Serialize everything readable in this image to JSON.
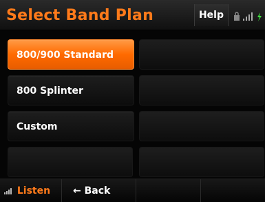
{
  "title": "Select Band Plan",
  "help_label": "Help",
  "options": [
    {
      "label": "800/900 Standard",
      "selected": true
    },
    {
      "label": "800 Splinter",
      "selected": false
    },
    {
      "label": "Custom",
      "selected": false
    }
  ],
  "bottom": {
    "listen_label": "Listen",
    "back_label": "← Back"
  },
  "icons": {
    "status": [
      "lock-icon",
      "signal-bars-icon",
      "battery-charge-icon"
    ],
    "listen": "signal-bars-icon"
  },
  "colors": {
    "accent": "#ff7a1a",
    "selected": "#ff6a00",
    "background": "#050505"
  }
}
